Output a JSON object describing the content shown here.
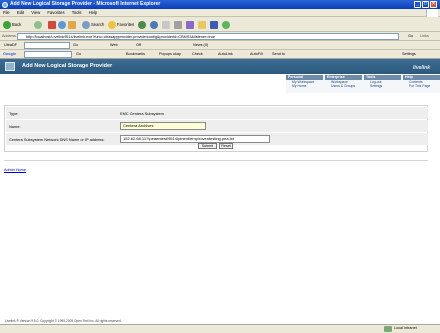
{
  "window": {
    "title": "Add New Logical Storage Provider - Microsoft Internet Explorer"
  },
  "menu": [
    "File",
    "Edit",
    "View",
    "Favorites",
    "Tools",
    "Help"
  ],
  "toolbar": {
    "back": "Back",
    "search": "Search",
    "favorites": "Favorites"
  },
  "address": {
    "label": "Address",
    "url": "http://localhost/Livelink9514/livelink.exe?func=otrasappprovider.providerconfig&providerid=CBMS3&listener=true",
    "go": "Go",
    "links": "Links"
  },
  "linksbar": {
    "ultradf": "UltraDF",
    "go": "Go",
    "web": "Web",
    "off": "Off",
    "news": "News (0)"
  },
  "googlebar": {
    "brand": "Google",
    "go": "Go",
    "bookmarks": "Bookmarks",
    "popups": "Popups okay",
    "check": "Check",
    "autolink": "AutoLink",
    "autofill": "AutoFill",
    "sendto": "Send to",
    "settings": "Settings"
  },
  "banner": {
    "title": "Add New Logical Storage Provider",
    "brand": "livelink"
  },
  "nav": [
    {
      "head": "Personal",
      "items": [
        "My Workspace",
        "My Home"
      ]
    },
    {
      "head": "Enterprise",
      "items": [
        "Workspace",
        "Users & Groups"
      ]
    },
    {
      "head": "Tools",
      "items": [
        "Log-out",
        "Settings"
      ]
    },
    {
      "head": "Help",
      "items": [
        "Contents",
        "For This Page"
      ]
    }
  ],
  "form": {
    "type_label": "Type:",
    "type_value": "EMC Centera Subsystem",
    "name_label": "Name:",
    "name_value": "Centera Archives",
    "network_label": "Centera Subsystem Network DNS Name or IP address:",
    "network_value": "152.62.68.11?\\peaentest\\9514\\pinent\\emp\\roventesting.pea.txt",
    "submit": "Submit",
    "reset": "Reset"
  },
  "admin_home": "Admin Home",
  "footer": "Livelink ® Version 9.5.0, Copyright © 1995-2005 Open Text Inc. All rights reserved.",
  "status": {
    "left": "",
    "zone": "Local intranet"
  },
  "colors": {
    "titlebar": "#0a3fb8",
    "banner": "#2f5b80",
    "form_row": "#eeeeee",
    "name_field": "#ffffd6",
    "link": "#0000cc"
  }
}
